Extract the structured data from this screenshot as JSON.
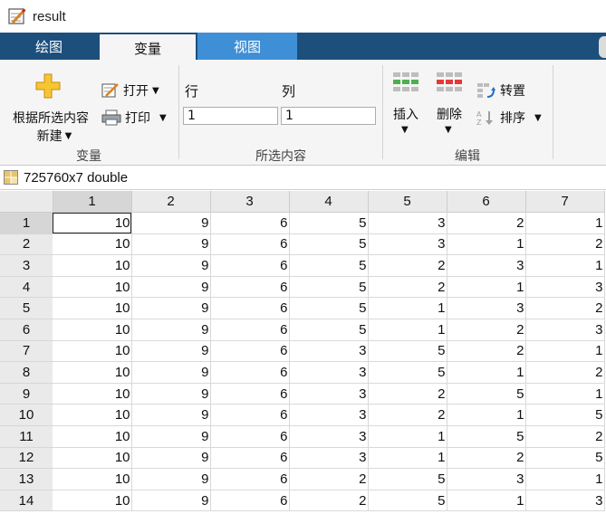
{
  "window": {
    "title": "result"
  },
  "tabs": [
    {
      "label": "绘图",
      "active": false
    },
    {
      "label": "变量",
      "active": true
    },
    {
      "label": "视图",
      "active": false
    }
  ],
  "toolstrip": {
    "variable_group": {
      "label": "变量",
      "new_from_selection_line1": "根据所选内容",
      "new_from_selection_line2": "新建",
      "open_label": "打开",
      "print_label": "打印"
    },
    "selection_group": {
      "label": "所选内容",
      "row_label": "行",
      "col_label": "列",
      "row_value": "1",
      "col_value": "1"
    },
    "edit_group": {
      "label": "编辑",
      "insert_label": "插入",
      "delete_label": "删除",
      "transpose_label": "转置",
      "sort_label": "排序"
    }
  },
  "variable": {
    "descriptor": "725760x7 double"
  },
  "grid": {
    "columns": [
      "1",
      "2",
      "3",
      "4",
      "5",
      "6",
      "7"
    ],
    "rows": [
      {
        "index": "1",
        "values": [
          "10",
          "9",
          "6",
          "5",
          "3",
          "2",
          "1"
        ]
      },
      {
        "index": "2",
        "values": [
          "10",
          "9",
          "6",
          "5",
          "3",
          "1",
          "2"
        ]
      },
      {
        "index": "3",
        "values": [
          "10",
          "9",
          "6",
          "5",
          "2",
          "3",
          "1"
        ]
      },
      {
        "index": "4",
        "values": [
          "10",
          "9",
          "6",
          "5",
          "2",
          "1",
          "3"
        ]
      },
      {
        "index": "5",
        "values": [
          "10",
          "9",
          "6",
          "5",
          "1",
          "3",
          "2"
        ]
      },
      {
        "index": "6",
        "values": [
          "10",
          "9",
          "6",
          "5",
          "1",
          "2",
          "3"
        ]
      },
      {
        "index": "7",
        "values": [
          "10",
          "9",
          "6",
          "3",
          "5",
          "2",
          "1"
        ]
      },
      {
        "index": "8",
        "values": [
          "10",
          "9",
          "6",
          "3",
          "5",
          "1",
          "2"
        ]
      },
      {
        "index": "9",
        "values": [
          "10",
          "9",
          "6",
          "3",
          "2",
          "5",
          "1"
        ]
      },
      {
        "index": "10",
        "values": [
          "10",
          "9",
          "6",
          "3",
          "2",
          "1",
          "5"
        ]
      },
      {
        "index": "11",
        "values": [
          "10",
          "9",
          "6",
          "3",
          "1",
          "5",
          "2"
        ]
      },
      {
        "index": "12",
        "values": [
          "10",
          "9",
          "6",
          "3",
          "1",
          "2",
          "5"
        ]
      },
      {
        "index": "13",
        "values": [
          "10",
          "9",
          "6",
          "2",
          "5",
          "3",
          "1"
        ]
      },
      {
        "index": "14",
        "values": [
          "10",
          "9",
          "6",
          "2",
          "5",
          "1",
          "3"
        ]
      }
    ],
    "selected_row": 0,
    "selected_col": 0
  },
  "colors": {
    "tab_strip": "#1d4f7c",
    "active_tab_view": "#3f8fd6",
    "toolstrip_bg": "#f5f5f5",
    "header_bg": "#eaeaea"
  }
}
